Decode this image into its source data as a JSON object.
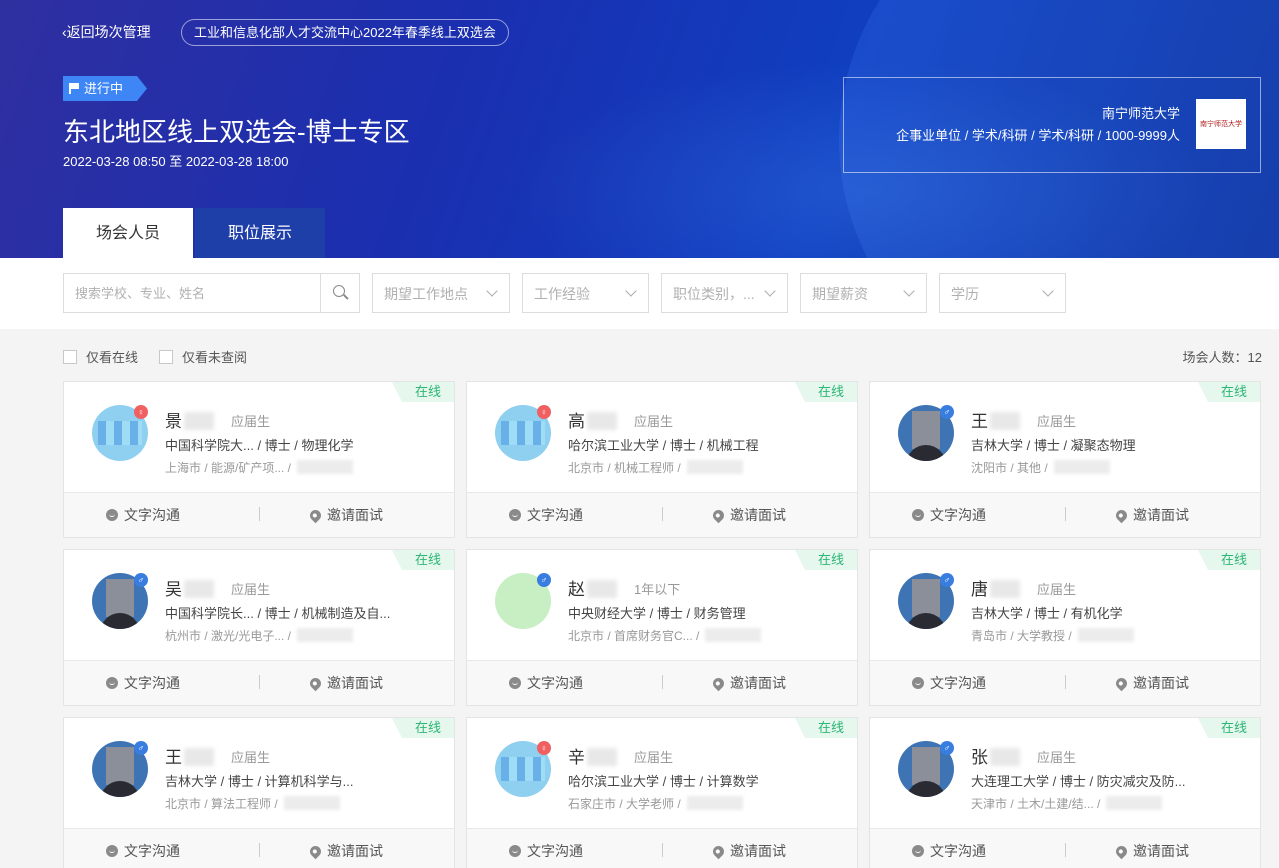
{
  "header": {
    "back_label": "返回场次管理",
    "fair_name": "工业和信息化部人才交流中心2022年春季线上双选会",
    "status_label": "进行中",
    "title": "东北地区线上双选会-博士专区",
    "time_range": "2022-03-28 08:50 至 2022-03-28 18:00",
    "company": {
      "name": "南宁师范大学",
      "info": "企事业单位 / 学术/科研 / 学术/科研 / 1000-9999人",
      "logo_text": "南宁师范大学"
    }
  },
  "tabs": [
    {
      "label": "场会人员",
      "active": true
    },
    {
      "label": "职位展示",
      "active": false
    }
  ],
  "filters": {
    "search_placeholder": "搜索学校、专业、姓名",
    "selects": [
      "期望工作地点",
      "工作经验",
      "职位类别，...",
      "期望薪资",
      "学历"
    ]
  },
  "toggles": {
    "online_only": "仅看在线",
    "unviewed_only": "仅看未查阅"
  },
  "attendee_count": "场会人数：12",
  "online_label": "在线",
  "action_chat": "文字沟通",
  "action_invite": "邀请面试",
  "colors": {
    "accent": "#3e86f5",
    "online": "#2bb673",
    "hero_dark": "#1a2fb0"
  },
  "cards": [
    {
      "name": "景",
      "tag": "应届生",
      "edu": "中国科学院大...  /  博士  /  物理化学",
      "loc": "上海市 /  能源/矿产项...  /",
      "avatar": "pix",
      "gender": "female"
    },
    {
      "name": "高",
      "tag": "应届生",
      "edu": "哈尔滨工业大学  /  博士  /  机械工程",
      "loc": "北京市 /  机械工程师  /",
      "avatar": "pix",
      "gender": "female"
    },
    {
      "name": "王",
      "tag": "应届生",
      "edu": "吉林大学  /  博士  /  凝聚态物理",
      "loc": "沈阳市 /  其他  /",
      "avatar": "photo",
      "gender": "male"
    },
    {
      "name": "吴",
      "tag": "应届生",
      "edu": "中国科学院长...  /  博士  /  机械制造及自...",
      "loc": "杭州市 /  激光/光电子...  /",
      "avatar": "photo",
      "gender": "male"
    },
    {
      "name": "赵",
      "tag": "1年以下",
      "edu": "中央财经大学  /  博士  /  财务管理",
      "loc": "北京市 /  首席财务官C...  /",
      "avatar": "green",
      "gender": "male"
    },
    {
      "name": "唐",
      "tag": "应届生",
      "edu": "吉林大学  /  博士  /  有机化学",
      "loc": "青岛市 /  大学教授  /",
      "avatar": "photo",
      "gender": "male"
    },
    {
      "name": "王",
      "tag": "应届生",
      "edu": "吉林大学  /  博士  /  计算机科学与...",
      "loc": "北京市 /  算法工程师  /",
      "avatar": "photo",
      "gender": "male"
    },
    {
      "name": "辛",
      "tag": "应届生",
      "edu": "哈尔滨工业大学  /  博士  /  计算数学",
      "loc": "石家庄市 /  大学老师  /",
      "avatar": "pix",
      "gender": "female"
    },
    {
      "name": "张",
      "tag": "应届生",
      "edu": "大连理工大学  /  博士  /  防灾减灾及防...",
      "loc": "天津市 /  土木/土建/结...  /",
      "avatar": "photo",
      "gender": "male"
    }
  ]
}
